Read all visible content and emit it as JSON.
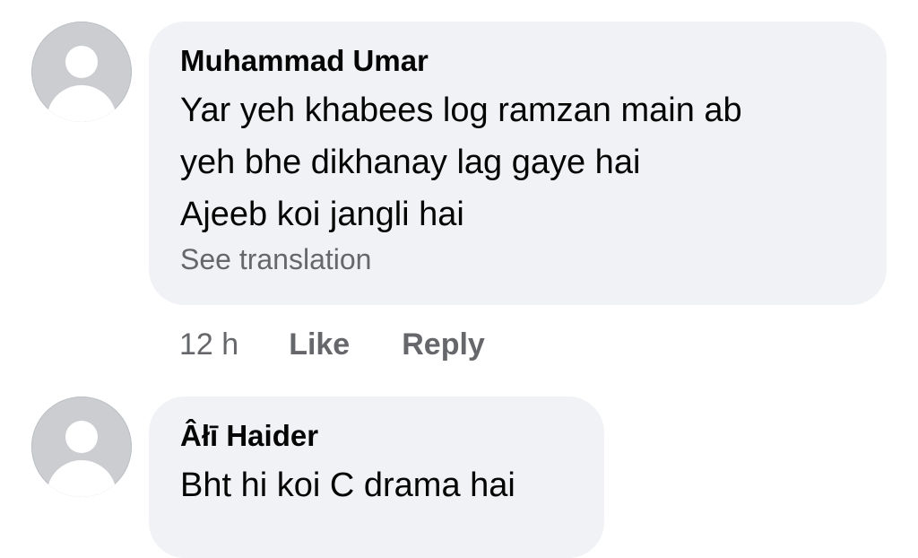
{
  "comments": [
    {
      "author": "Muhammad Umar",
      "lines": [
        "Yar yeh khabees log ramzan main ab",
        "yeh bhe dikhanay lag gaye hai",
        "Ajeeb koi jangli hai"
      ],
      "see_translation": "See translation",
      "time": "12 h",
      "like_label": "Like",
      "reply_label": "Reply",
      "avatar_icon": "default-profile-icon"
    },
    {
      "author": "Âłī Haider",
      "lines": [
        "Bht hi koi C drama hai"
      ],
      "avatar_icon": "default-profile-icon"
    }
  ],
  "colors": {
    "bubble_bg": "#f0f2f5",
    "secondary_text": "#65676b",
    "primary_text": "#050505",
    "avatar_bg": "#cbcdd1"
  }
}
